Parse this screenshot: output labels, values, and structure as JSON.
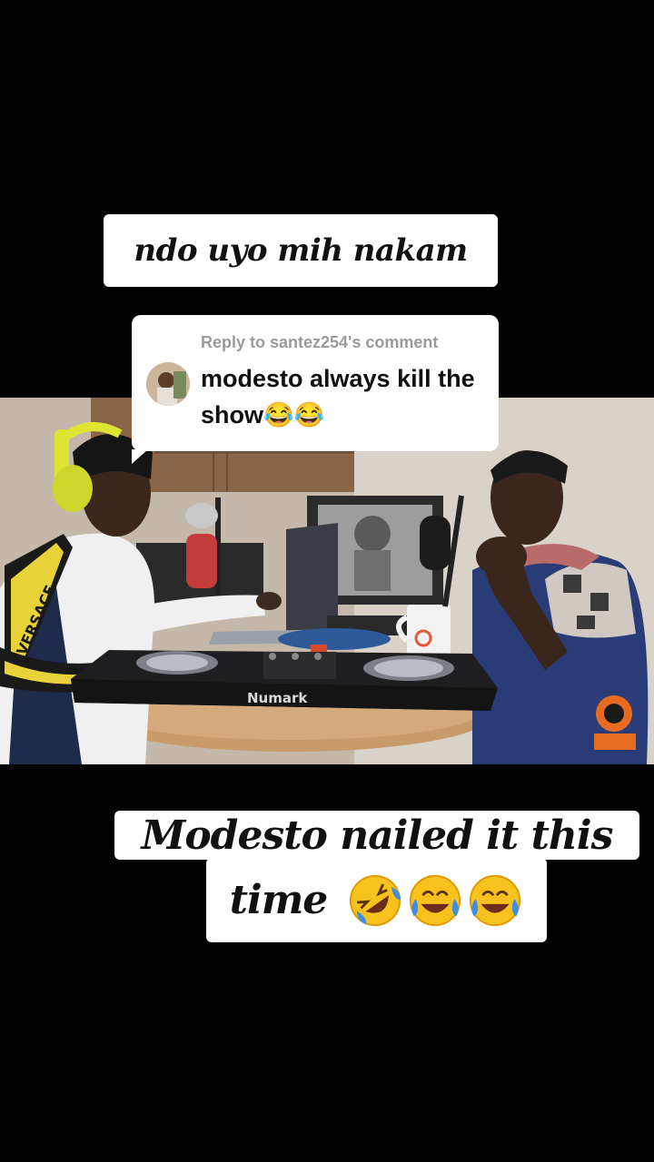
{
  "caption_top": {
    "text": "ndo uyo mih nakam"
  },
  "reply_comment": {
    "header": "Reply to santez254's comment",
    "text": "modesto always kill the show😂😂"
  },
  "caption_bottom": {
    "line1": "Modesto nailed it this",
    "line2": "time",
    "emojis": [
      "rolling-on-floor-laughing",
      "tears-of-joy",
      "tears-of-joy"
    ]
  },
  "video": {
    "mixer_brand": "Numark",
    "jacket_text": "VERSACE"
  }
}
